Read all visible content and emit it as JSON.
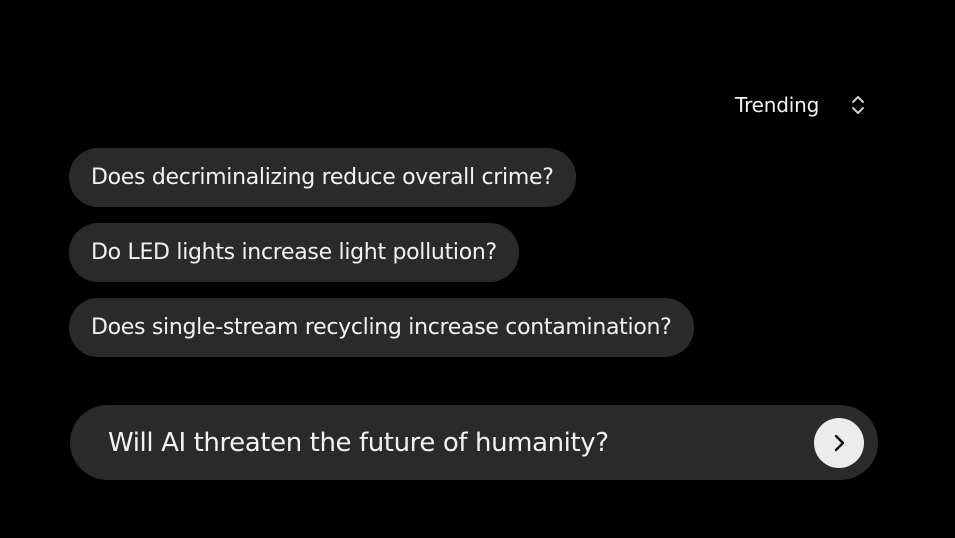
{
  "sort": {
    "selected": "Trending",
    "icon": "chevron-up-down-icon"
  },
  "suggestions": [
    {
      "label": "Does decriminalizing reduce overall crime?"
    },
    {
      "label": "Do LED lights increase light pollution?"
    },
    {
      "label": "Does single-stream recycling increase contamination?"
    }
  ],
  "query": {
    "value": "Will AI threaten the future of humanity?",
    "submit_icon": "chevron-right-icon"
  },
  "colors": {
    "background": "#000000",
    "surface": "#2a2a2a",
    "text": "#f2f2f2",
    "button": "#ececec"
  }
}
